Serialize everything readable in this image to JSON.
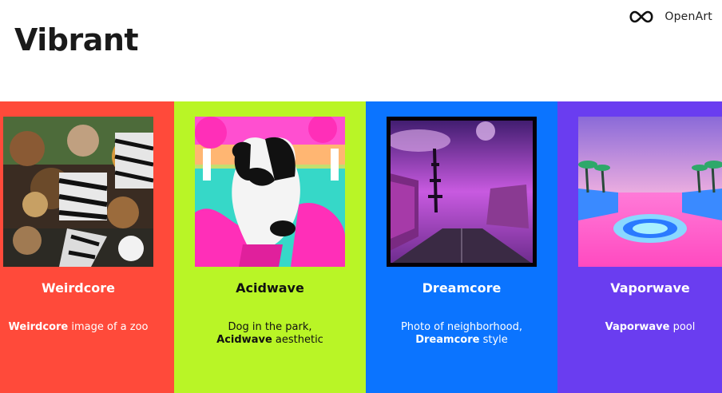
{
  "brand": {
    "name": "OpenArt",
    "icon": "infinity-icon"
  },
  "page": {
    "title": "Vibrant"
  },
  "colors": {
    "weirdcore": "#ff4a3a",
    "acidwave": "#b9f526",
    "dreamcore": "#0b74ff",
    "vaporwave": "#6a3df0"
  },
  "cards": [
    {
      "title": "Weirdcore",
      "desc_bold": "Weirdcore",
      "desc_rest": " image of a zoo",
      "desc_prefix": ""
    },
    {
      "title": "Acidwave",
      "desc_prefix": "Dog in the park,",
      "desc_bold": "Acidwave",
      "desc_rest": " aesthetic"
    },
    {
      "title": "Dreamcore",
      "desc_prefix": "Photo of neighborhood,",
      "desc_bold": "Dreamcore",
      "desc_rest": " style"
    },
    {
      "title": "Vaporwave",
      "desc_prefix": "",
      "desc_bold": "Vaporwave",
      "desc_rest": " pool"
    }
  ]
}
